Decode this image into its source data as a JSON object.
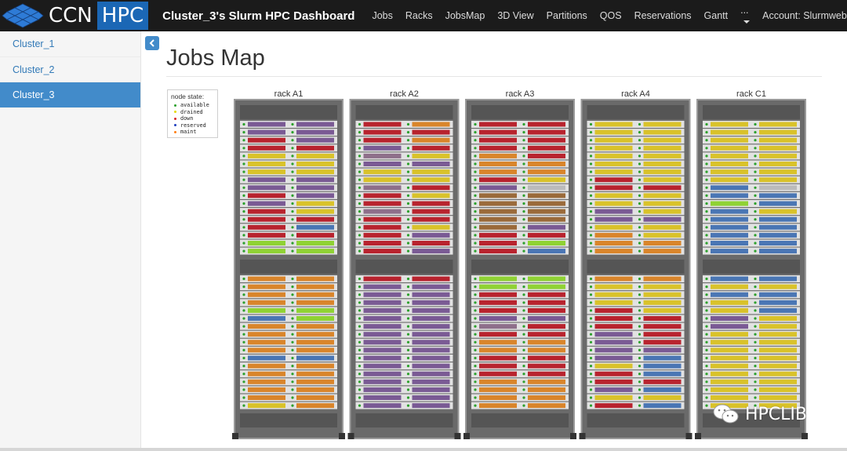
{
  "brand": {
    "ccn": "CCN",
    "hpc": "HPC"
  },
  "navbar": {
    "title": "Cluster_3's Slurm HPC Dashboard",
    "links": [
      "Jobs",
      "Racks",
      "JobsMap",
      "3D View",
      "Partitions",
      "QOS",
      "Reservations",
      "Gantt"
    ],
    "more": "...",
    "account": "Account: Slurmweb User"
  },
  "sidebar": {
    "items": [
      {
        "label": "Cluster_1",
        "active": false
      },
      {
        "label": "Cluster_2",
        "active": false
      },
      {
        "label": "Cluster_3",
        "active": true
      }
    ]
  },
  "page": {
    "title": "Jobs Map"
  },
  "legend": {
    "title": "node state:",
    "items": [
      {
        "label": "available",
        "color": "#2ca02c"
      },
      {
        "label": "drained",
        "color": "#e5d800"
      },
      {
        "label": "down",
        "color": "#d62728"
      },
      {
        "label": "reserved",
        "color": "#1f3fbf"
      },
      {
        "label": "maint",
        "color": "#ff7f0e"
      }
    ]
  },
  "racks": [
    {
      "name": "rack A1"
    },
    {
      "name": "rack A2"
    },
    {
      "name": "rack A3"
    },
    {
      "name": "rack A4"
    },
    {
      "name": "rack C1"
    }
  ],
  "job_colors": {
    "purple": "#7a5a94",
    "red": "#b8232e",
    "yellow": "#d9c22a",
    "orange": "#d9852b",
    "green": "#8fd234",
    "blue": "#4a76b4",
    "brown": "#9a6a3a",
    "gray": "#bbbbbb",
    "mauve": "#8e6f8a"
  },
  "watermark": {
    "text": "HPCLIB"
  }
}
